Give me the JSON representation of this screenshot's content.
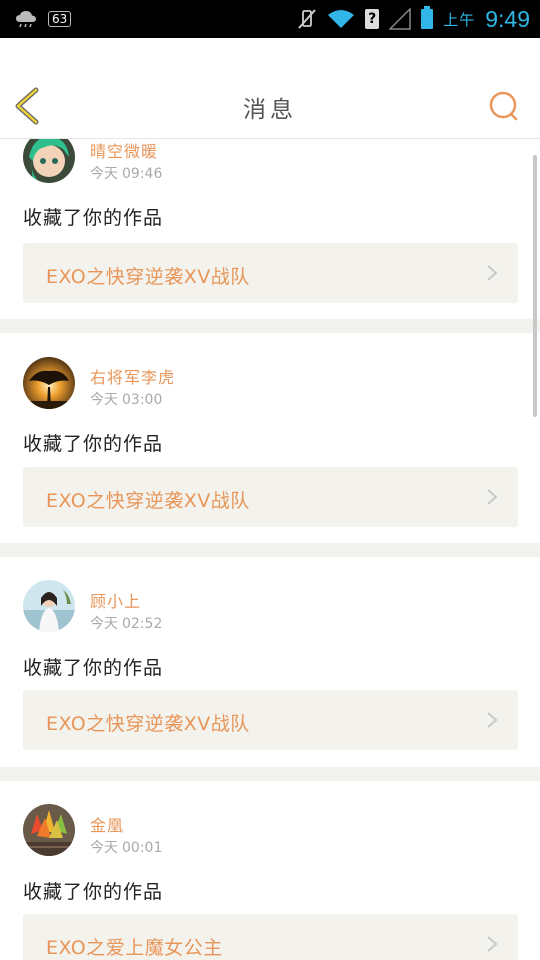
{
  "status_bar": {
    "badge": "63",
    "sim_label": "?",
    "ampm": "上午",
    "time": "9:49"
  },
  "header": {
    "title": "消息"
  },
  "colors": {
    "accent": "#e8965a",
    "time_blue": "#31b6e7",
    "back_arrow": "#f0d33a"
  },
  "messages": [
    {
      "user": "晴空微暖",
      "time_day": "今天",
      "time": "09:46",
      "action": "收藏了你的作品",
      "work": "EXO之快穿逆袭XV战队"
    },
    {
      "user": "右将军李虎",
      "time_day": "今天",
      "time": "03:00",
      "action": "收藏了你的作品",
      "work": "EXO之快穿逆袭XV战队"
    },
    {
      "user": "顾小上",
      "time_day": "今天",
      "time": "02:52",
      "action": "收藏了你的作品",
      "work": "EXO之快穿逆袭XV战队"
    },
    {
      "user": "金凰",
      "time_day": "今天",
      "time": "00:01",
      "action": "收藏了你的作品",
      "work": "EXO之爱上魔女公主"
    }
  ]
}
